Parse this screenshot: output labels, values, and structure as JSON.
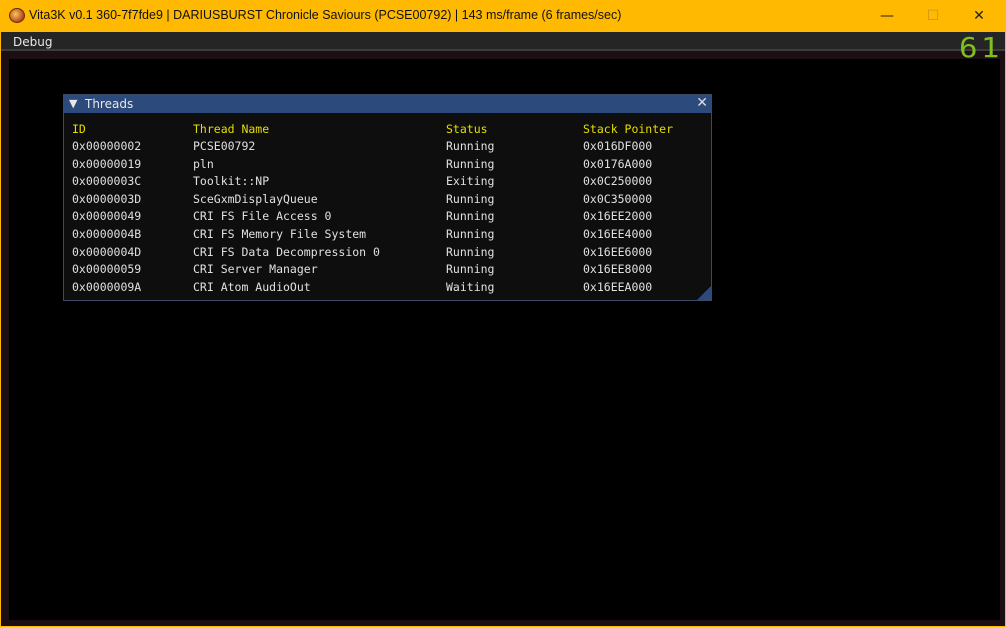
{
  "window": {
    "title": "Vita3K v0.1 360-7f7fde9 | DARIUSBURST Chronicle Saviours (PCSE00792) | 143 ms/frame (6 frames/sec)",
    "minimize": "—",
    "maximize": "☐",
    "close": "✕"
  },
  "menu": {
    "debug": "Debug"
  },
  "fps": "61",
  "threads": {
    "title": "Threads",
    "collapse_icon": "▼",
    "close_icon": "✕",
    "columns": [
      "ID",
      "Thread Name",
      "Status",
      "Stack Pointer"
    ],
    "rows": [
      [
        "0x00000002",
        "PCSE00792",
        "Running",
        "0x016DF000"
      ],
      [
        "0x00000019",
        "pln",
        "Running",
        "0x0176A000"
      ],
      [
        "0x0000003C",
        "Toolkit::NP",
        "Exiting",
        "0x0C250000"
      ],
      [
        "0x0000003D",
        "SceGxmDisplayQueue",
        "Running",
        "0x0C350000"
      ],
      [
        "0x00000049",
        "CRI FS File Access 0",
        "Running",
        "0x16EE2000"
      ],
      [
        "0x0000004B",
        "CRI FS Memory File System",
        "Running",
        "0x16EE4000"
      ],
      [
        "0x0000004D",
        "CRI FS Data Decompression 0",
        "Running",
        "0x16EE6000"
      ],
      [
        "0x00000059",
        "CRI Server Manager",
        "Running",
        "0x16EE8000"
      ],
      [
        "0x0000009A",
        "CRI Atom AudioOut",
        "Waiting",
        "0x16EEA000"
      ]
    ]
  }
}
